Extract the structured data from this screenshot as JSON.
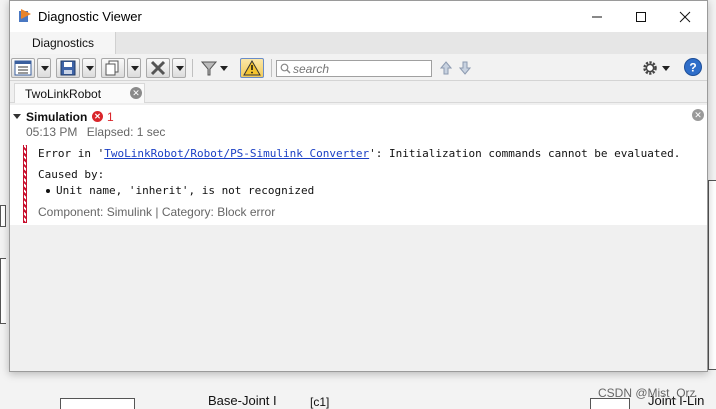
{
  "window": {
    "title": "Diagnostic Viewer"
  },
  "tabs": [
    {
      "label": "Diagnostics"
    }
  ],
  "search": {
    "placeholder": "search"
  },
  "doc_tab": {
    "label": "TwoLinkRobot"
  },
  "simulation": {
    "title": "Simulation",
    "error_count": "1",
    "time": "05:13 PM",
    "elapsed": "Elapsed: 1 sec"
  },
  "error": {
    "prefix": "Error in '",
    "link": "TwoLinkRobot/Robot/PS-Simulink Converter",
    "suffix": "': Initialization commands cannot be evaluated.",
    "caused_by": "Caused by:",
    "cause": "Unit name, 'inherit', is not recognized",
    "component": "Component: Simulink | Category: Block error"
  },
  "background": {
    "label_base_joint": "Base-Joint I",
    "label_joint": "Joint I-Lin",
    "label_c1": "[c1]"
  },
  "watermark": "CSDN @Mist_Orz",
  "colors": {
    "error": "#d9262b",
    "link": "#1a3fc4"
  }
}
